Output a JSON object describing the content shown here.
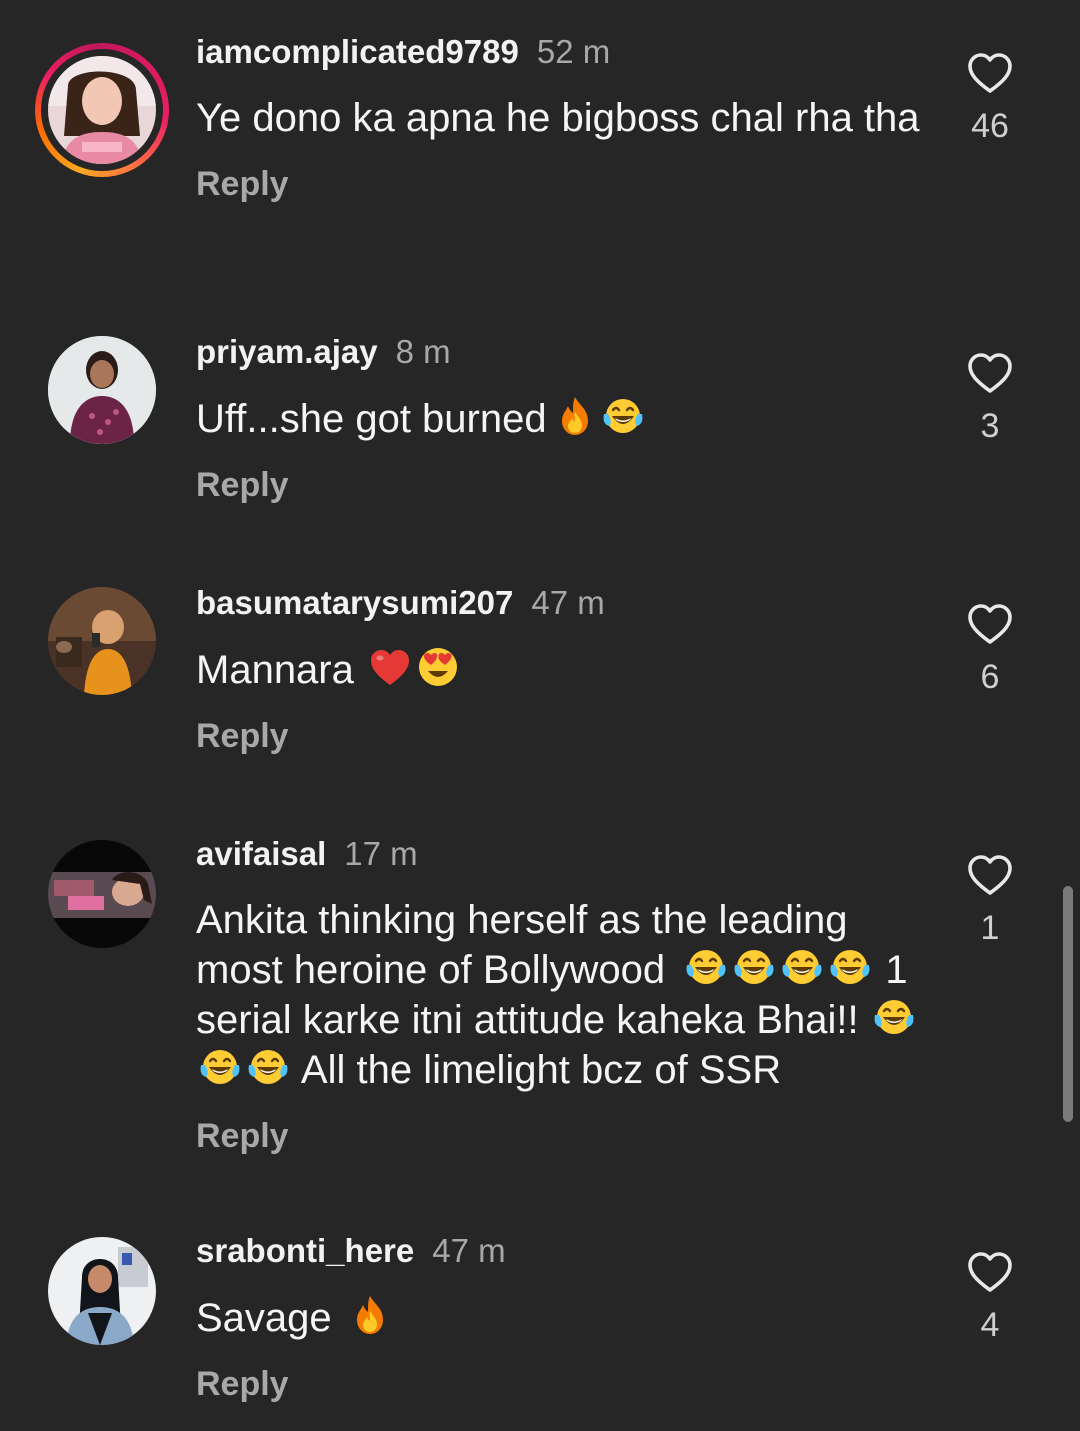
{
  "comments": [
    {
      "username": "iamcomplicated9789",
      "time": "52 m",
      "text": "Ye dono ka apna he bigboss chal rha tha",
      "reply_label": "Reply",
      "likes": "46",
      "has_story_ring": true
    },
    {
      "username": "priyam.ajay",
      "time": "8 m",
      "text": "Uff...she got burned",
      "emojis": [
        "fire",
        "tears-of-joy"
      ],
      "reply_label": "Reply",
      "likes": "3"
    },
    {
      "username": "basumatarysumi207",
      "time": "47 m",
      "text": "Mannara",
      "emojis": [
        "red-heart",
        "heart-eyes"
      ],
      "reply_label": "Reply",
      "likes": "6"
    },
    {
      "username": "avifaisal",
      "time": "17 m",
      "text_part1": "Ankita thinking herself as the leading most heroine of Bollywood",
      "emojis_1": [
        "tears-of-joy",
        "tears-of-joy",
        "tears-of-joy",
        "tears-of-joy"
      ],
      "text_part2": "1 serial karke itni attitude kaheka Bhai!!",
      "emojis_2": [
        "tears-of-joy",
        "tears-of-joy",
        "tears-of-joy"
      ],
      "text_part3": "All the limelight bcz of SSR",
      "reply_label": "Reply",
      "likes": "1"
    },
    {
      "username": "srabonti_here",
      "time": "47 m",
      "text": "Savage",
      "emojis": [
        "fire"
      ],
      "reply_label": "Reply",
      "likes": "4"
    }
  ],
  "colors": {
    "background": "#262626",
    "primary_text": "#f5f5f5",
    "secondary_text": "#a8a8a8"
  }
}
